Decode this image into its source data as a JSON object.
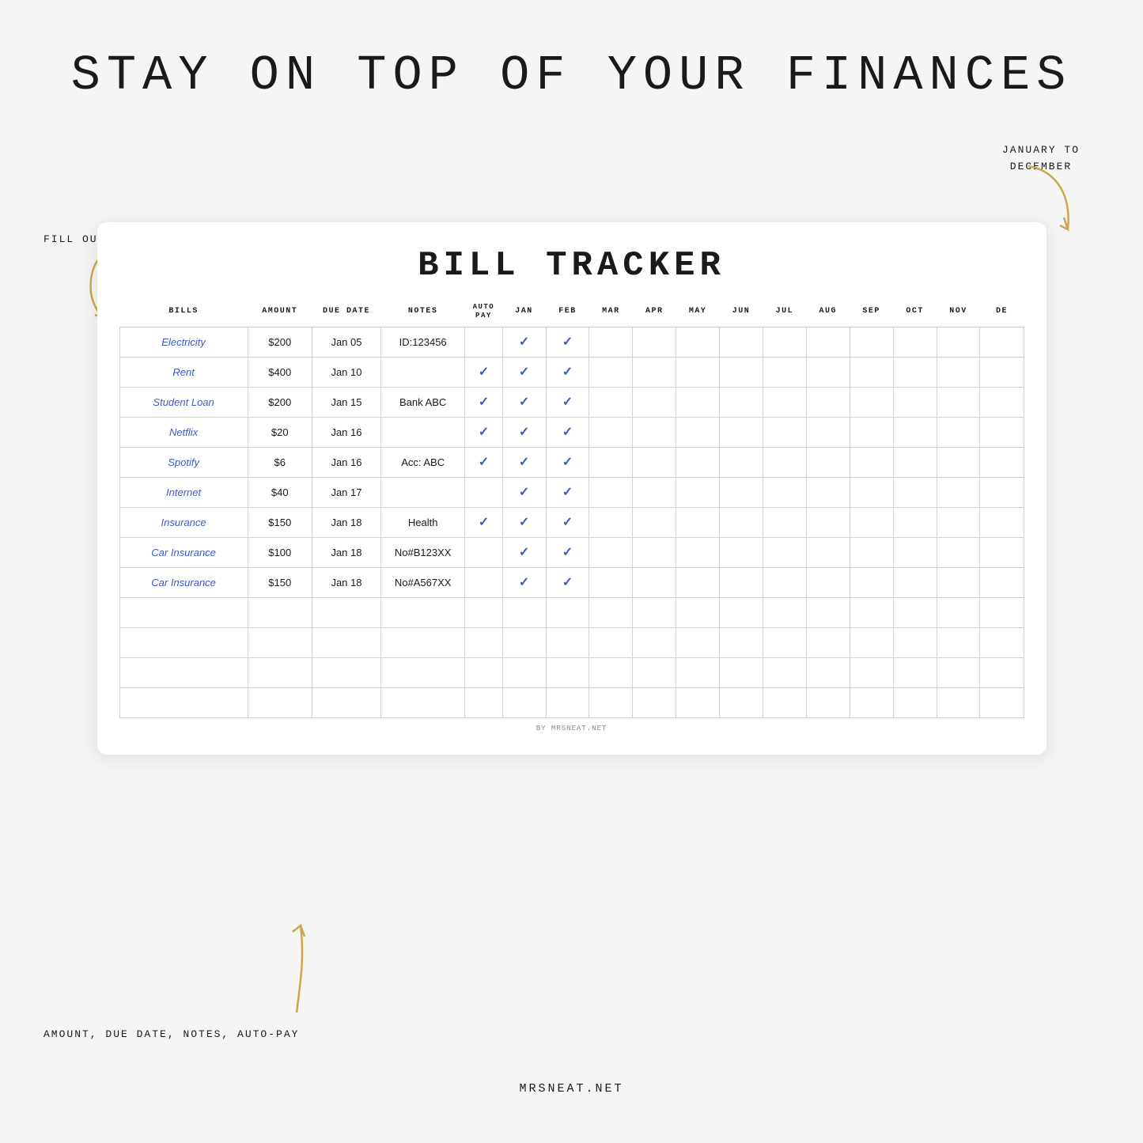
{
  "page": {
    "title": "STAY ON TOP OF YOUR FINANCES",
    "date_range": "JANUARY TO\nDECEMBER",
    "fill_label": "FILL OUT WITH BILLS",
    "amount_label": "AMOUNT, DUE DATE, NOTES, AUTO-PAY",
    "footer_url": "MRSNEAT.NET",
    "by_credit": "BY MRSNEAT.NET"
  },
  "tracker": {
    "title": "BILL TRACKER",
    "headers": {
      "bills": "BILLS",
      "amount": "AMOUNT",
      "due_date": "DUE DATE",
      "notes": "NOTES",
      "autopay": "AUTO PAY",
      "months": [
        "JAN",
        "FEB",
        "MAR",
        "APR",
        "MAY",
        "JUN",
        "JUL",
        "AUG",
        "SEP",
        "OCT",
        "NOV",
        "DE"
      ]
    },
    "rows": [
      {
        "bill": "Electricity",
        "amount": "$200",
        "due_date": "Jan 05",
        "notes": "ID:123456",
        "autopay": false,
        "jan": true,
        "feb": true,
        "mar": false,
        "apr": false,
        "may": false,
        "jun": false,
        "jul": false,
        "aug": false,
        "sep": false,
        "oct": false,
        "nov": false,
        "dec": false
      },
      {
        "bill": "Rent",
        "amount": "$400",
        "due_date": "Jan 10",
        "notes": "",
        "autopay": true,
        "jan": true,
        "feb": true,
        "mar": false,
        "apr": false,
        "may": false,
        "jun": false,
        "jul": false,
        "aug": false,
        "sep": false,
        "oct": false,
        "nov": false,
        "dec": false
      },
      {
        "bill": "Student Loan",
        "amount": "$200",
        "due_date": "Jan 15",
        "notes": "Bank ABC",
        "autopay": true,
        "jan": true,
        "feb": true,
        "mar": false,
        "apr": false,
        "may": false,
        "jun": false,
        "jul": false,
        "aug": false,
        "sep": false,
        "oct": false,
        "nov": false,
        "dec": false
      },
      {
        "bill": "Netflix",
        "amount": "$20",
        "due_date": "Jan 16",
        "notes": "",
        "autopay": true,
        "jan": true,
        "feb": true,
        "mar": false,
        "apr": false,
        "may": false,
        "jun": false,
        "jul": false,
        "aug": false,
        "sep": false,
        "oct": false,
        "nov": false,
        "dec": false
      },
      {
        "bill": "Spotify",
        "amount": "$6",
        "due_date": "Jan 16",
        "notes": "Acc: ABC",
        "autopay": true,
        "jan": true,
        "feb": true,
        "mar": false,
        "apr": false,
        "may": false,
        "jun": false,
        "jul": false,
        "aug": false,
        "sep": false,
        "oct": false,
        "nov": false,
        "dec": false
      },
      {
        "bill": "Internet",
        "amount": "$40",
        "due_date": "Jan 17",
        "notes": "",
        "autopay": false,
        "jan": true,
        "feb": true,
        "mar": false,
        "apr": false,
        "may": false,
        "jun": false,
        "jul": false,
        "aug": false,
        "sep": false,
        "oct": false,
        "nov": false,
        "dec": false
      },
      {
        "bill": "Insurance",
        "amount": "$150",
        "due_date": "Jan 18",
        "notes": "Health",
        "autopay": true,
        "jan": true,
        "feb": true,
        "mar": false,
        "apr": false,
        "may": false,
        "jun": false,
        "jul": false,
        "aug": false,
        "sep": false,
        "oct": false,
        "nov": false,
        "dec": false
      },
      {
        "bill": "Car Insurance",
        "amount": "$100",
        "due_date": "Jan 18",
        "notes": "No#B123XX",
        "autopay": false,
        "jan": true,
        "feb": true,
        "mar": false,
        "apr": false,
        "may": false,
        "jun": false,
        "jul": false,
        "aug": false,
        "sep": false,
        "oct": false,
        "nov": false,
        "dec": false
      },
      {
        "bill": "Car Insurance",
        "amount": "$150",
        "due_date": "Jan 18",
        "notes": "No#A567XX",
        "autopay": false,
        "jan": true,
        "feb": true,
        "mar": false,
        "apr": false,
        "may": false,
        "jun": false,
        "jul": false,
        "aug": false,
        "sep": false,
        "oct": false,
        "nov": false,
        "dec": false
      }
    ],
    "empty_rows": 4
  }
}
